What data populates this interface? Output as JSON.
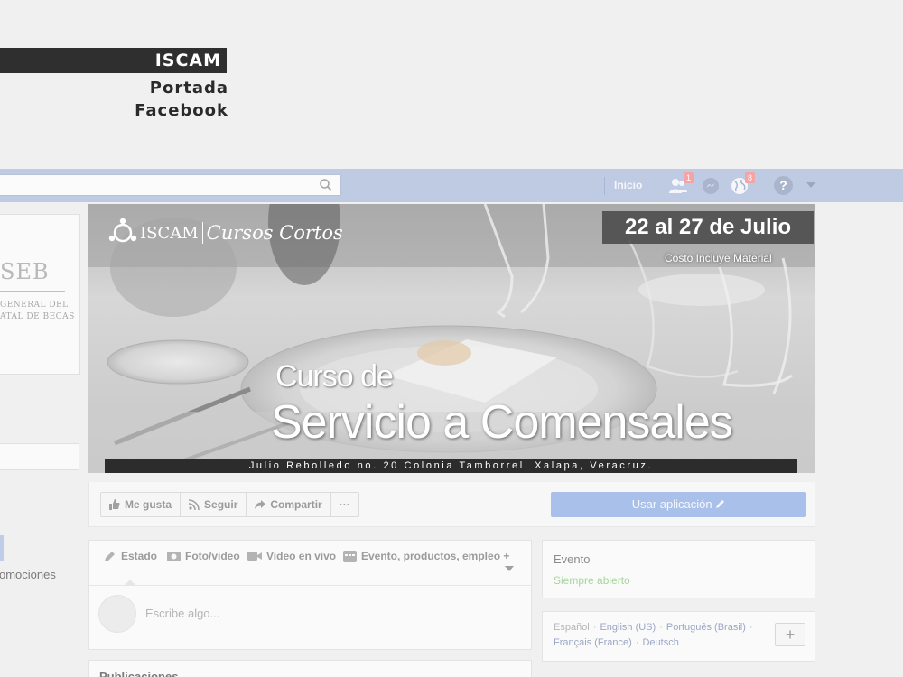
{
  "header": {
    "brand": "ISCAM",
    "subtitle_line1": "Portada",
    "subtitle_line2": "Facebook"
  },
  "topbar": {
    "search_placeholder": "",
    "home_label": "Inicio",
    "friend_requests_count": "1",
    "notifications_count": "8",
    "help_label": "?"
  },
  "profile": {
    "logo_text": "SEB",
    "logo_sub1": "GENERAL DEL",
    "logo_sub2": "ATAL DE BECAS",
    "promo_text": "omociones"
  },
  "cover": {
    "logo_brand": "ISCAM",
    "logo_script": "Cursos Cortos",
    "date": "22 al 27 de Julio",
    "cost_note": "Costo Incluye Material",
    "heading_small": "Curso de",
    "heading_large": "Servicio a Comensales",
    "address": "Julio Rebolledo no. 20 Colonia Tamborrel. Xalapa, Veracruz."
  },
  "actions": {
    "like": "Me gusta",
    "follow": "Seguir",
    "share": "Compartir",
    "more": "···",
    "use_app": "Usar aplicación"
  },
  "composer": {
    "tabs": [
      "Estado",
      "Foto/video",
      "Video en vivo",
      "Evento, productos, empleo +"
    ],
    "placeholder": "Escribe algo..."
  },
  "posts": {
    "heading": "Publicaciones"
  },
  "sidebar": {
    "event_title": "Evento",
    "event_status": "Siempre abierto",
    "languages_current": "Español",
    "languages_line1": [
      "English (US)",
      "Português (Brasil)"
    ],
    "languages_line2": [
      "Français (France)",
      "Deutsch"
    ],
    "add_label": "+"
  },
  "colors": {
    "topbar": "#bfcbe3",
    "use_app_button": "#a8c0ea",
    "event_status": "#a7d59a"
  }
}
